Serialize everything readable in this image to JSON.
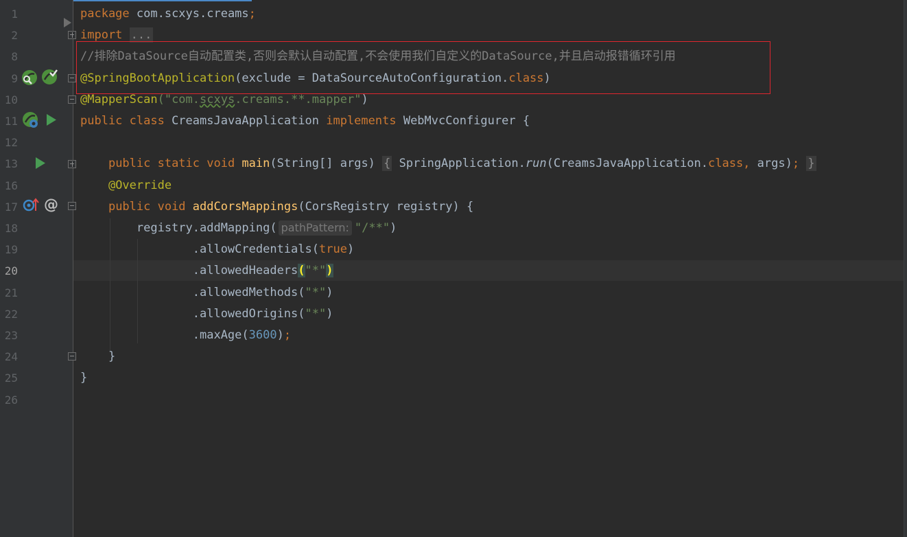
{
  "editor": {
    "lines": [
      {
        "num": "1",
        "parts": [
          {
            "t": "package",
            "c": "kw"
          },
          {
            "t": " com.scxys.creams"
          },
          {
            "t": ";",
            "c": "punc"
          }
        ]
      },
      {
        "num": "2",
        "parts": [
          {
            "t": "import",
            "c": "kw"
          },
          {
            "t": " "
          },
          {
            "t": "...",
            "c": "fold-box"
          }
        ]
      },
      {
        "num": "8",
        "parts": [
          {
            "t": "//排除DataSource自动配置类,否则会默认自动配置,不会使用我们自定义的DataSource,并且启动报错循环引用",
            "c": "cmt"
          }
        ]
      },
      {
        "num": "9",
        "parts": [
          {
            "t": "@SpringBootApplication",
            "c": "ann"
          },
          {
            "t": "(exclude = DataSourceAutoConfiguration."
          },
          {
            "t": "class",
            "c": "kw"
          },
          {
            "t": ")"
          }
        ]
      },
      {
        "num": "10",
        "parts": [
          {
            "t": "@MapperScan",
            "c": "ann"
          },
          {
            "t": "(\"com.",
            "c": "str"
          },
          {
            "t": "scxys",
            "c": "str squiggle"
          },
          {
            "t": ".creams.**.mapper\"",
            "c": "str"
          },
          {
            "t": ")"
          }
        ]
      },
      {
        "num": "11",
        "parts": [
          {
            "t": "public class",
            "c": "kw"
          },
          {
            "t": " CreamsJavaApplication "
          },
          {
            "t": "implements",
            "c": "kw"
          },
          {
            "t": " WebMvcConfigurer {"
          }
        ]
      },
      {
        "num": "12",
        "parts": []
      },
      {
        "num": "13",
        "parts": [
          {
            "t": "    "
          },
          {
            "t": "public static void",
            "c": "kw"
          },
          {
            "t": " "
          },
          {
            "t": "main",
            "c": "fn"
          },
          {
            "t": "(String[] args) "
          },
          {
            "t": "{",
            "c": "fold-box"
          },
          {
            "t": " SpringApplication."
          },
          {
            "t": "run",
            "c": "it"
          },
          {
            "t": "(CreamsJavaApplication."
          },
          {
            "t": "class,",
            "c": "kw"
          },
          {
            "t": " args)"
          },
          {
            "t": ";",
            "c": "punc"
          },
          {
            "t": " "
          },
          {
            "t": "}",
            "c": "fold-box"
          }
        ]
      },
      {
        "num": "16",
        "parts": [
          {
            "t": "    "
          },
          {
            "t": "@Override",
            "c": "ann"
          }
        ]
      },
      {
        "num": "17",
        "parts": [
          {
            "t": "    "
          },
          {
            "t": "public void",
            "c": "kw"
          },
          {
            "t": " "
          },
          {
            "t": "addCorsMappings",
            "c": "fn"
          },
          {
            "t": "(CorsRegistry registry) {"
          }
        ]
      },
      {
        "num": "18",
        "parts": [
          {
            "t": "        registry.addMapping("
          },
          {
            "t": "pathPattern:",
            "c": "hint"
          },
          {
            "t": "\"/**\"",
            "c": "str"
          },
          {
            "t": ")"
          }
        ]
      },
      {
        "num": "19",
        "parts": [
          {
            "t": "                .allowCredentials("
          },
          {
            "t": "true",
            "c": "kw"
          },
          {
            "t": ")"
          }
        ]
      },
      {
        "num": "20",
        "active": true,
        "parts": [
          {
            "t": "                .allowedHeaders"
          },
          {
            "t": "(",
            "c": "brace-hl"
          },
          {
            "t": "\"*\"",
            "c": "str"
          },
          {
            "t": ")",
            "c": "brace-hl"
          }
        ]
      },
      {
        "num": "21",
        "parts": [
          {
            "t": "                .allowedMethods("
          },
          {
            "t": "\"*\"",
            "c": "str"
          },
          {
            "t": ")"
          }
        ]
      },
      {
        "num": "22",
        "parts": [
          {
            "t": "                .allowedOrigins("
          },
          {
            "t": "\"*\"",
            "c": "str"
          },
          {
            "t": ")"
          }
        ]
      },
      {
        "num": "23",
        "parts": [
          {
            "t": "                .maxAge("
          },
          {
            "t": "3600",
            "c": "num"
          },
          {
            "t": ")"
          },
          {
            "t": ";",
            "c": "punc"
          }
        ]
      },
      {
        "num": "24",
        "parts": [
          {
            "t": "    }"
          }
        ]
      },
      {
        "num": "25",
        "parts": [
          {
            "t": "}"
          }
        ]
      },
      {
        "num": "26",
        "parts": []
      }
    ]
  },
  "gutter_icons": [
    {
      "line": "1",
      "name": "fold-marker-icon"
    },
    {
      "line": "9",
      "name": "spring-bean-search-icon"
    },
    {
      "line": "9",
      "name": "spring-config-icon"
    },
    {
      "line": "11",
      "name": "spring-boot-icon"
    },
    {
      "line": "11",
      "name": "run-icon"
    },
    {
      "line": "13",
      "name": "run-icon"
    },
    {
      "line": "17",
      "name": "override-method-icon"
    },
    {
      "line": "17",
      "name": "at-annotation-icon"
    }
  ],
  "colors": {
    "background": "#2b2b2b",
    "gutter": "#313335",
    "keyword": "#cc7832",
    "annotation": "#bbb529",
    "string": "#6a8759",
    "number": "#6897bb",
    "comment": "#808080",
    "method": "#ffc66d",
    "highlight_box": "#e0262e"
  }
}
